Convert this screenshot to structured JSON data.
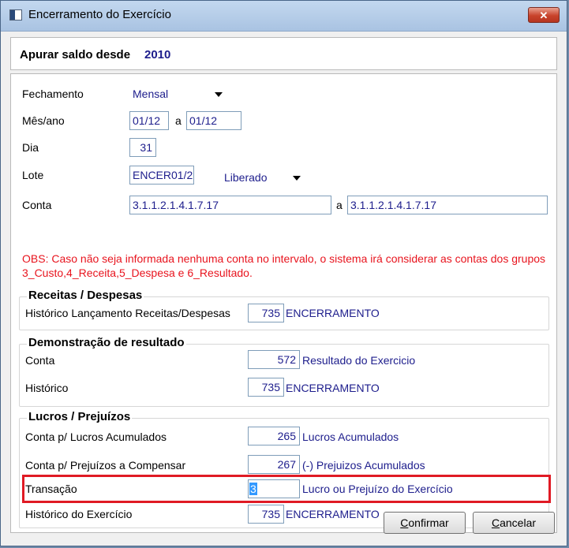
{
  "window": {
    "title": "Encerramento do Exercício",
    "close_label": "✕"
  },
  "header": {
    "label": "Apurar saldo desde",
    "year": "2010"
  },
  "form": {
    "fechamento": {
      "label": "Fechamento",
      "value": "Mensal"
    },
    "mes_ano": {
      "label": "Mês/ano",
      "from": "01/12",
      "sep": "a",
      "to": "01/12"
    },
    "dia": {
      "label": "Dia",
      "value": "31"
    },
    "lote": {
      "label": "Lote",
      "value": "ENCER01/2",
      "status": "Liberado"
    },
    "conta": {
      "label": "Conta",
      "from": "3.1.1.2.1.4.1.7.17",
      "sep": "a",
      "to": "3.1.1.2.1.4.1.7.17"
    },
    "obs": "OBS: Caso não seja informada nenhuma conta no intervalo, o sistema irá considerar as contas dos grupos 3_Custo,4_Receita,5_Despesa e 6_Resultado."
  },
  "receitas": {
    "title": "Receitas / Despesas",
    "historico": {
      "label": "Histórico Lançamento Receitas/Despesas",
      "code": "735",
      "desc": "ENCERRAMENTO"
    }
  },
  "demonstracao": {
    "title": "Demonstração de resultado",
    "conta": {
      "label": "Conta",
      "code": "572",
      "desc": "Resultado do Exercicio"
    },
    "historico": {
      "label": "Histórico",
      "code": "735",
      "desc": "ENCERRAMENTO"
    }
  },
  "lucros": {
    "title": "Lucros / Prejuízos",
    "conta_lucros": {
      "label": "Conta p/ Lucros Acumulados",
      "code": "265",
      "desc": "Lucros Acumulados"
    },
    "conta_prejuizos": {
      "label": "Conta p/ Prejuízos a Compensar",
      "code": "267",
      "desc": "(-) Prejuizos Acumulados"
    },
    "transacao": {
      "label": "Transação",
      "code": "3",
      "desc": "Lucro ou Prejuízo do Exercício"
    },
    "historico_exercicio": {
      "label": "Histórico do Exercício",
      "code": "735",
      "desc": "ENCERRAMENTO"
    }
  },
  "buttons": {
    "confirm_first": "C",
    "confirm_rest": "onfirmar",
    "cancel_first": "C",
    "cancel_rest": "ancelar"
  },
  "colors": {
    "accent_blue": "#1d1d8c",
    "warning_red": "#e8141e",
    "highlight_red": "#e01a24"
  }
}
